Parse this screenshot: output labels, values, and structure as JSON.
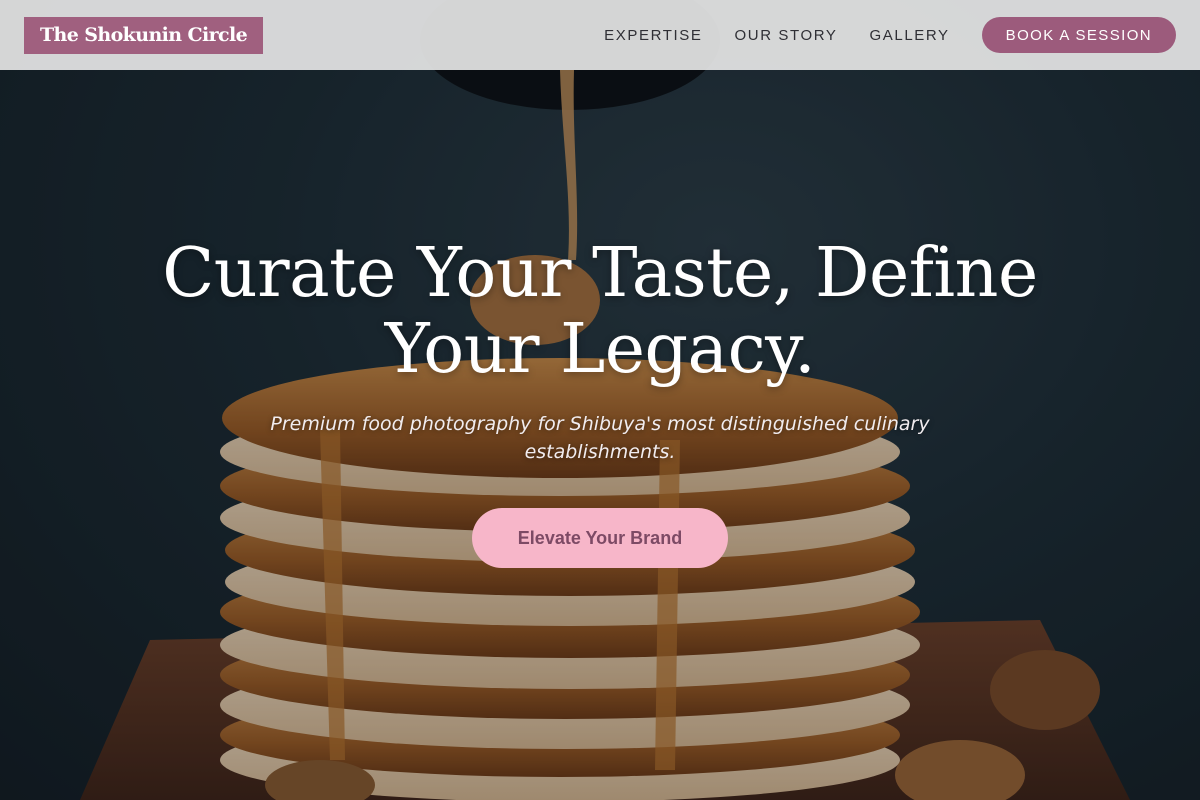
{
  "brand": {
    "name": "The Shokunin Circle",
    "accent": "#9c5b7c",
    "cta_color": "#f7b6c9"
  },
  "nav": {
    "links": [
      "EXPERTISE",
      "OUR STORY",
      "GALLERY"
    ],
    "book_label": "BOOK A SESSION"
  },
  "hero": {
    "headline_line1": "Curate Your Taste, Define",
    "headline_line2": "Your Legacy.",
    "subheadline": "Premium food photography for Shibuya's most distinguished culinary establishments.",
    "cta_label": "Elevate Your Brand",
    "background_image": "pancake-stack-with-syrup-photo"
  }
}
